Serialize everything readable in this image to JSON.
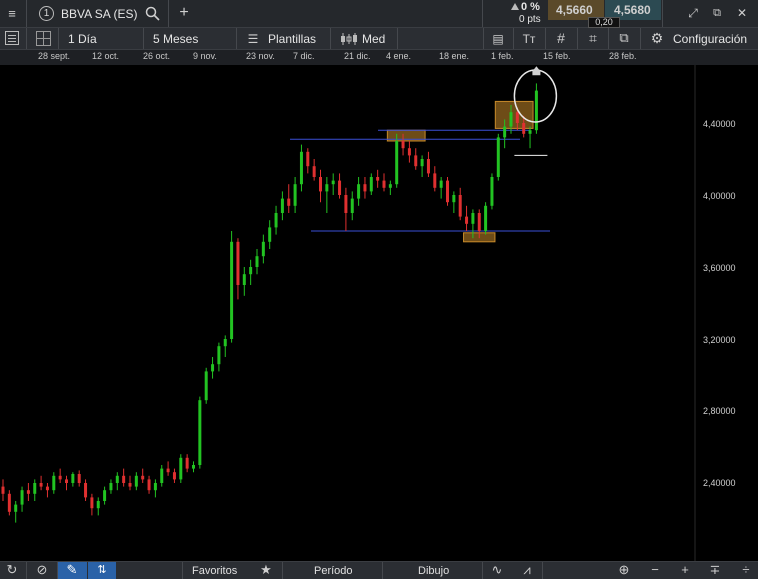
{
  "header": {
    "symbol_number": "1",
    "symbol": "BBVA SA (ES)",
    "change_pct": "0 %",
    "change_pts": "0 pts",
    "bid": "4,5660",
    "ask": "4,5680",
    "spread": "0,20"
  },
  "toolbar": {
    "interval": "1 Día",
    "range": "5 Meses",
    "templates": "Plantillas",
    "price_type": "Med",
    "settings": "Configuración"
  },
  "dates": [
    "28 sept.",
    "12 oct.",
    "26 oct.",
    "9 nov.",
    "23 nov.",
    "7 dic.",
    "21 dic.",
    "4 ene.",
    "18 ene.",
    "1 feb.",
    "15 feb.",
    "28 feb."
  ],
  "bottom": {
    "favorites": "Favoritos",
    "period": "Período",
    "drawing": "Dibujo"
  },
  "colors": {
    "up": "#22c322",
    "down": "#e03030",
    "support_line": "#3a4fd6",
    "zone": "#c88a2a",
    "bid_bg": "#5b4a2a",
    "ask_bg": "#2c4a52"
  },
  "chart_data": {
    "type": "candlestick",
    "ylim": [
      2.2,
      4.7
    ],
    "y_ticks": [
      "4,40000",
      "4,00000",
      "3,60000",
      "3,20000",
      "2,80000",
      "2,40000"
    ],
    "y_tick_values": [
      4.4,
      4.0,
      3.6,
      3.2,
      2.8,
      2.4
    ],
    "x_labels": [
      "28 sept.",
      "12 oct.",
      "26 oct.",
      "9 nov.",
      "23 nov.",
      "7 dic.",
      "21 dic.",
      "4 ene.",
      "18 ene.",
      "1 feb.",
      "15 feb.",
      "28 feb."
    ],
    "candles": [
      [
        2.38,
        2.42,
        2.3,
        2.34
      ],
      [
        2.34,
        2.36,
        2.22,
        2.24
      ],
      [
        2.24,
        2.3,
        2.18,
        2.28
      ],
      [
        2.28,
        2.38,
        2.24,
        2.36
      ],
      [
        2.36,
        2.4,
        2.3,
        2.34
      ],
      [
        2.34,
        2.42,
        2.3,
        2.4
      ],
      [
        2.4,
        2.44,
        2.36,
        2.38
      ],
      [
        2.38,
        2.4,
        2.32,
        2.36
      ],
      [
        2.36,
        2.46,
        2.34,
        2.44
      ],
      [
        2.44,
        2.48,
        2.4,
        2.42
      ],
      [
        2.42,
        2.44,
        2.36,
        2.4
      ],
      [
        2.4,
        2.46,
        2.38,
        2.45
      ],
      [
        2.45,
        2.47,
        2.38,
        2.4
      ],
      [
        2.4,
        2.42,
        2.3,
        2.32
      ],
      [
        2.32,
        2.34,
        2.22,
        2.26
      ],
      [
        2.26,
        2.32,
        2.22,
        2.3
      ],
      [
        2.3,
        2.38,
        2.28,
        2.36
      ],
      [
        2.36,
        2.42,
        2.34,
        2.4
      ],
      [
        2.4,
        2.46,
        2.36,
        2.44
      ],
      [
        2.44,
        2.48,
        2.38,
        2.4
      ],
      [
        2.4,
        2.44,
        2.36,
        2.38
      ],
      [
        2.38,
        2.46,
        2.36,
        2.44
      ],
      [
        2.44,
        2.48,
        2.4,
        2.42
      ],
      [
        2.42,
        2.44,
        2.34,
        2.36
      ],
      [
        2.36,
        2.42,
        2.32,
        2.4
      ],
      [
        2.4,
        2.5,
        2.38,
        2.48
      ],
      [
        2.48,
        2.52,
        2.44,
        2.46
      ],
      [
        2.46,
        2.48,
        2.4,
        2.42
      ],
      [
        2.42,
        2.56,
        2.4,
        2.54
      ],
      [
        2.54,
        2.56,
        2.46,
        2.48
      ],
      [
        2.48,
        2.52,
        2.46,
        2.5
      ],
      [
        2.5,
        2.88,
        2.48,
        2.86
      ],
      [
        2.86,
        3.04,
        2.84,
        3.02
      ],
      [
        3.02,
        3.1,
        2.98,
        3.06
      ],
      [
        3.06,
        3.18,
        3.02,
        3.16
      ],
      [
        3.16,
        3.22,
        3.1,
        3.2
      ],
      [
        3.2,
        3.8,
        3.18,
        3.74
      ],
      [
        3.74,
        3.76,
        3.42,
        3.5
      ],
      [
        3.5,
        3.6,
        3.44,
        3.56
      ],
      [
        3.56,
        3.64,
        3.5,
        3.6
      ],
      [
        3.6,
        3.7,
        3.56,
        3.66
      ],
      [
        3.66,
        3.78,
        3.62,
        3.74
      ],
      [
        3.74,
        3.86,
        3.7,
        3.82
      ],
      [
        3.82,
        3.94,
        3.78,
        3.9
      ],
      [
        3.9,
        4.02,
        3.86,
        3.98
      ],
      [
        3.98,
        4.06,
        3.9,
        3.94
      ],
      [
        3.94,
        4.1,
        3.9,
        4.06
      ],
      [
        4.06,
        4.28,
        4.02,
        4.24
      ],
      [
        4.24,
        4.26,
        4.12,
        4.16
      ],
      [
        4.16,
        4.2,
        4.08,
        4.1
      ],
      [
        4.1,
        4.14,
        3.96,
        4.02
      ],
      [
        4.02,
        4.1,
        3.9,
        4.06
      ],
      [
        4.06,
        4.12,
        4.0,
        4.08
      ],
      [
        4.08,
        4.12,
        3.98,
        4.0
      ],
      [
        4.0,
        4.04,
        3.8,
        3.9
      ],
      [
        3.9,
        4.02,
        3.86,
        3.98
      ],
      [
        3.98,
        4.1,
        3.94,
        4.06
      ],
      [
        4.06,
        4.1,
        3.98,
        4.02
      ],
      [
        4.02,
        4.12,
        4.0,
        4.1
      ],
      [
        4.1,
        4.14,
        4.04,
        4.08
      ],
      [
        4.08,
        4.12,
        4.02,
        4.04
      ],
      [
        4.04,
        4.08,
        4.0,
        4.06
      ],
      [
        4.06,
        4.34,
        4.04,
        4.3
      ],
      [
        4.3,
        4.34,
        4.22,
        4.26
      ],
      [
        4.26,
        4.3,
        4.18,
        4.22
      ],
      [
        4.22,
        4.26,
        4.14,
        4.16
      ],
      [
        4.16,
        4.22,
        4.1,
        4.2
      ],
      [
        4.2,
        4.24,
        4.1,
        4.12
      ],
      [
        4.12,
        4.16,
        4.02,
        4.04
      ],
      [
        4.04,
        4.1,
        3.98,
        4.08
      ],
      [
        4.08,
        4.1,
        3.94,
        3.96
      ],
      [
        3.96,
        4.02,
        3.9,
        4.0
      ],
      [
        4.0,
        4.04,
        3.86,
        3.88
      ],
      [
        3.88,
        3.94,
        3.8,
        3.84
      ],
      [
        3.84,
        3.92,
        3.76,
        3.9
      ],
      [
        3.9,
        3.92,
        3.76,
        3.8
      ],
      [
        3.8,
        3.96,
        3.78,
        3.94
      ],
      [
        3.94,
        4.12,
        3.92,
        4.1
      ],
      [
        4.1,
        4.34,
        4.08,
        4.32
      ],
      [
        4.32,
        4.42,
        4.26,
        4.38
      ],
      [
        4.38,
        4.5,
        4.34,
        4.46
      ],
      [
        4.46,
        4.48,
        4.36,
        4.4
      ],
      [
        4.4,
        4.44,
        4.32,
        4.34
      ],
      [
        4.34,
        4.38,
        4.26,
        4.36
      ],
      [
        4.36,
        4.62,
        4.34,
        4.58
      ]
    ],
    "horizontal_lines": [
      4.31,
      4.36,
      3.8
    ],
    "zones": [
      {
        "from_index": 61,
        "to_index": 66,
        "low": 4.3,
        "high": 4.36
      },
      {
        "from_index": 73,
        "to_index": 77,
        "low": 3.74,
        "high": 3.79
      },
      {
        "from_index": 78,
        "to_index": 83,
        "low": 4.37,
        "high": 4.52
      }
    ]
  }
}
